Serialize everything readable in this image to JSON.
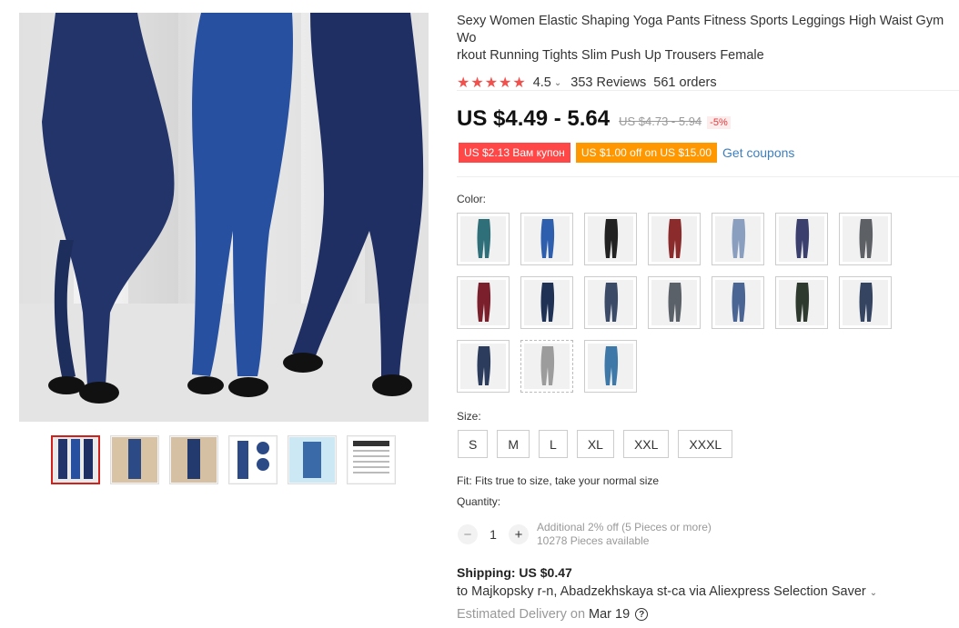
{
  "product": {
    "title": "Sexy Women Elastic Shaping Yoga Pants Fitness Sports Leggings High Waist Gym Workout Running Tights Slim Push Up Trousers Female",
    "title_line1": "Sexy Women Elastic Shaping Yoga Pants Fitness Sports Leggings High Waist Gym Wo",
    "title_line2": "rkout Running Tights Slim Push Up Trousers Female",
    "rating": {
      "stars_filled": 5,
      "score": "4.5",
      "reviews": "353 Reviews",
      "orders": "561 orders"
    }
  },
  "price": {
    "current": "US $4.49 - 5.64",
    "original": "US $4.73 - 5.94",
    "discount": "-5%"
  },
  "coupons": {
    "coupon1": "US $2.13 Вам купон",
    "coupon2": "US $1.00 off on US $15.00",
    "get_coupons": "Get coupons"
  },
  "color": {
    "label": "Color:",
    "swatches": [
      {
        "name": "teal-print",
        "fill": "#2e6f7a"
      },
      {
        "name": "bright-blue",
        "fill": "#2d5fae"
      },
      {
        "name": "black",
        "fill": "#222222"
      },
      {
        "name": "wine-red",
        "fill": "#8b2b2b"
      },
      {
        "name": "light-blue",
        "fill": "#8a9fc0"
      },
      {
        "name": "navy-print",
        "fill": "#3a3f6e"
      },
      {
        "name": "grey-print",
        "fill": "#5d6064"
      },
      {
        "name": "burgundy",
        "fill": "#7a1f2b"
      },
      {
        "name": "dark-navy",
        "fill": "#1f3256"
      },
      {
        "name": "denim-print-1",
        "fill": "#3b4a66"
      },
      {
        "name": "grey-denim",
        "fill": "#5b6169"
      },
      {
        "name": "mid-blue",
        "fill": "#4a6494"
      },
      {
        "name": "black-print",
        "fill": "#2f3a2e"
      },
      {
        "name": "denim-print-2",
        "fill": "#344461"
      },
      {
        "name": "navy-denim",
        "fill": "#2c3c5c"
      },
      {
        "name": "light-grey",
        "fill": "#9c9c9c"
      },
      {
        "name": "blue-teal",
        "fill": "#3d78a8"
      }
    ]
  },
  "size": {
    "label": "Size:",
    "options": [
      "S",
      "M",
      "L",
      "XL",
      "XXL",
      "XXXL"
    ]
  },
  "fit_note": "Fit: Fits true to size, take your normal size",
  "quantity": {
    "label": "Quantity:",
    "value": "1",
    "minus": "−",
    "plus": "+",
    "note1": "Additional 2% off (5 Pieces or more)",
    "note2": "10278 Pieces available"
  },
  "shipping": {
    "label": "Shipping: US $0.47",
    "to": "to Majkopsky r-n, Abadzekhskaya st-ca via Aliexpress Selection Saver",
    "delivery_prefix": "Estimated Delivery on",
    "delivery_date": "Mar 19"
  },
  "colors": {
    "accent_red": "#ff4747",
    "accent_orange": "#ff9800",
    "link_blue": "#3c7fbf",
    "star_red": "#f0514d"
  }
}
